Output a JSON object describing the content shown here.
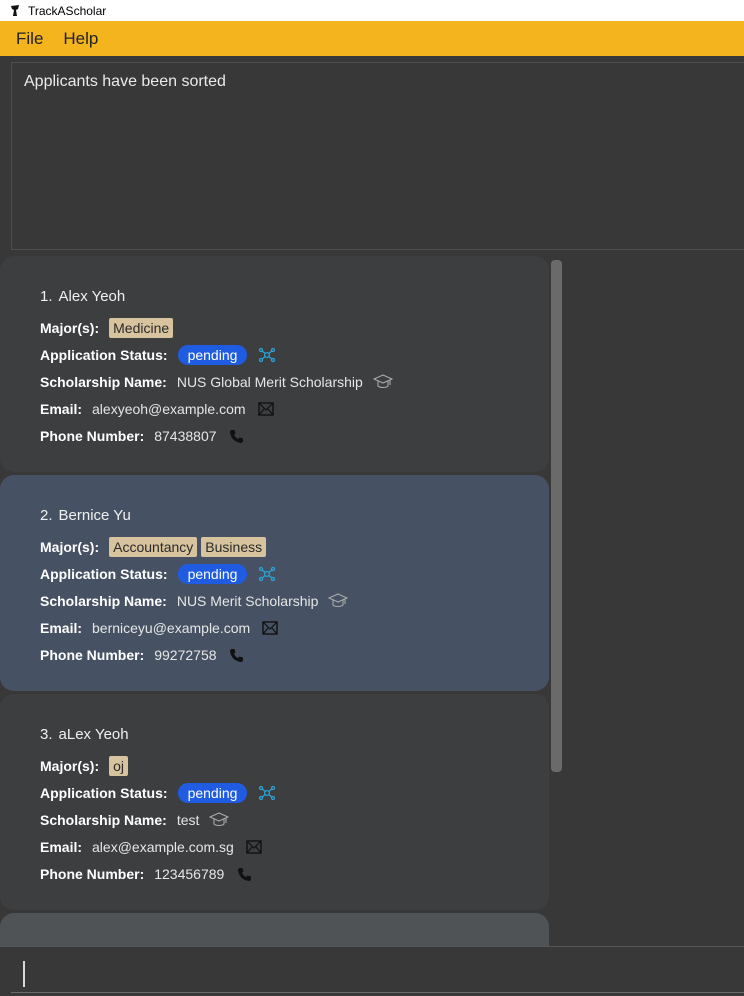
{
  "window": {
    "title": "TrackAScholar"
  },
  "menu": {
    "file": "File",
    "help": "Help"
  },
  "result": {
    "text": "Applicants have been sorted"
  },
  "labels": {
    "majors": "Major(s):",
    "status": "Application Status:",
    "scholarship": "Scholarship Name:",
    "email": "Email:",
    "phone": "Phone Number:"
  },
  "applicants": [
    {
      "index": "1.",
      "name": "Alex Yeoh",
      "majors": [
        "Medicine"
      ],
      "status": "pending",
      "scholarship": "NUS Global Merit Scholarship",
      "email": "alexyeoh@example.com",
      "phone": "87438807"
    },
    {
      "index": "2.",
      "name": "Bernice Yu",
      "majors": [
        "Accountancy",
        "Business"
      ],
      "status": "pending",
      "scholarship": "NUS Merit Scholarship",
      "email": "berniceyu@example.com",
      "phone": "99272758"
    },
    {
      "index": "3.",
      "name": "aLex Yeoh",
      "majors": [
        "oj"
      ],
      "status": "pending",
      "scholarship": "test",
      "email": "alex@example.com.sg",
      "phone": "123456789"
    }
  ],
  "command": {
    "value": ""
  },
  "colors": {
    "menu_bar": "#f3b41d",
    "status_badge": "#1f5ce2",
    "major_tag": "#d7c39e",
    "selected_card": "#465264"
  },
  "icons": {
    "status": "network-icon",
    "scholarship": "graduation-cap-icon",
    "email": "envelope-icon",
    "phone": "phone-icon"
  }
}
